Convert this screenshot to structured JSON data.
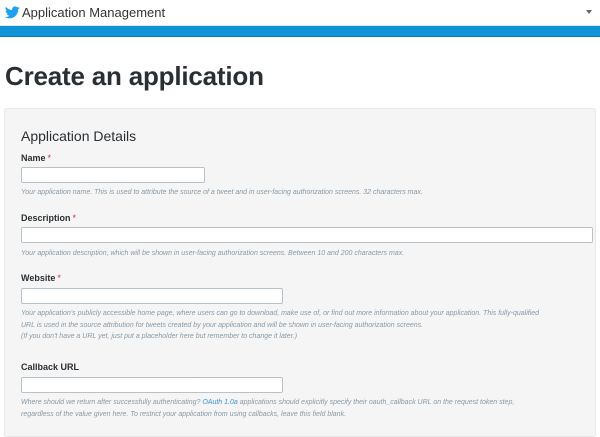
{
  "header": {
    "app_title": "Application Management",
    "logo_icon": "twitter-bird-icon",
    "menu_icon": "caret-down-icon",
    "brand_color": "#1da1f2",
    "band_color": "#0f94d8"
  },
  "page": {
    "title": "Create an application"
  },
  "form": {
    "section_title": "Application Details",
    "required_marker": "*",
    "name": {
      "label": "Name",
      "value": "",
      "help": "Your application name. This is used to attribute the source of a tweet and in user-facing authorization screens. 32 characters max."
    },
    "description": {
      "label": "Description",
      "value": "",
      "help": "Your application description, which will be shown in user-facing authorization screens. Between 10 and 200 characters max."
    },
    "website": {
      "label": "Website",
      "value": "",
      "help_line1": "Your application's publicly accessible home page, where users can go to download, make use of, or find out more information about your application. This fully-qualified",
      "help_line2": "URL is used in the source attribution for tweets created by your application and will be shown in user-facing authorization screens.",
      "help_line3": "(If you don't have a URL yet, just put a placeholder here but remember to change it later.)"
    },
    "callback": {
      "label": "Callback URL",
      "value": "",
      "help_pre": "Where should we return after successfully authenticating? ",
      "help_link": "OAuth 1.0a",
      "help_post": " applications should explicitly specify their oauth_callback URL on the request token step,",
      "help_line2": "regardless of the value given here. To restrict your application from using callbacks, leave this field blank."
    }
  }
}
